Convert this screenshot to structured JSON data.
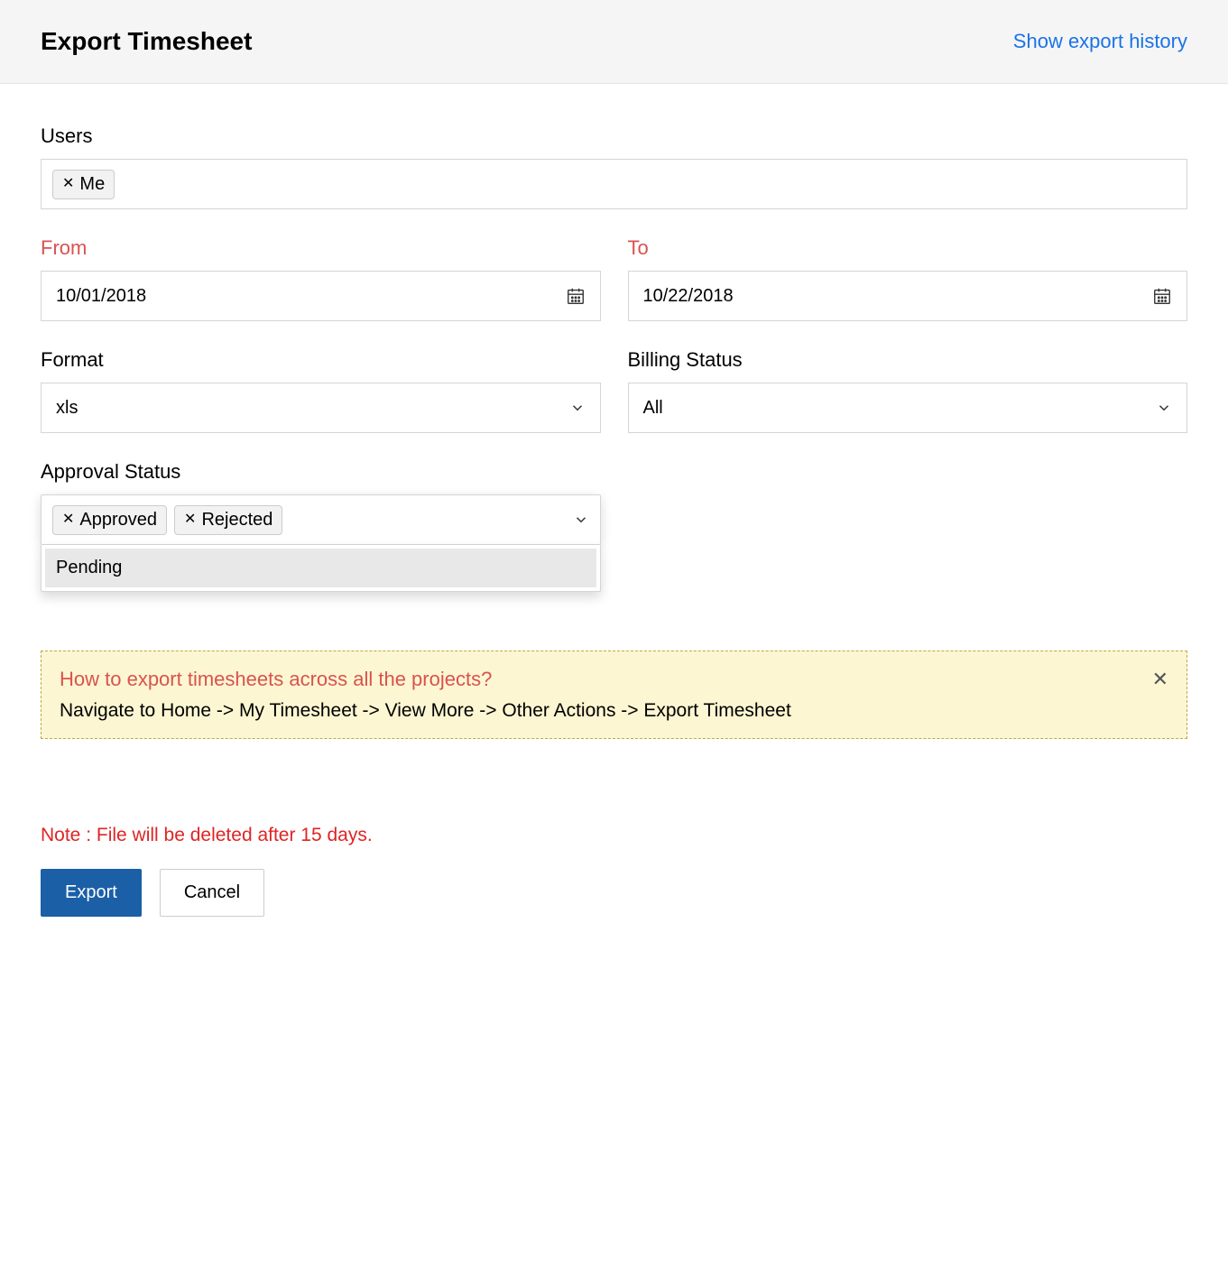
{
  "header": {
    "title": "Export Timesheet",
    "history_link": "Show export history"
  },
  "users": {
    "label": "Users",
    "tags": {
      "me": "Me"
    }
  },
  "from": {
    "label": "From",
    "value": "10/01/2018"
  },
  "to": {
    "label": "To",
    "value": "10/22/2018"
  },
  "format": {
    "label": "Format",
    "value": "xls"
  },
  "billing": {
    "label": "Billing Status",
    "value": "All"
  },
  "approval": {
    "label": "Approval Status",
    "tags": {
      "approved": "Approved",
      "rejected": "Rejected"
    },
    "dropdown": {
      "pending": "Pending"
    }
  },
  "help": {
    "title": "How to export timesheets across all the projects?",
    "text": "Navigate to Home -> My Timesheet -> View More -> Other Actions -> Export Timesheet"
  },
  "note": "Note : File will be deleted after 15 days.",
  "actions": {
    "export": "Export",
    "cancel": "Cancel"
  }
}
